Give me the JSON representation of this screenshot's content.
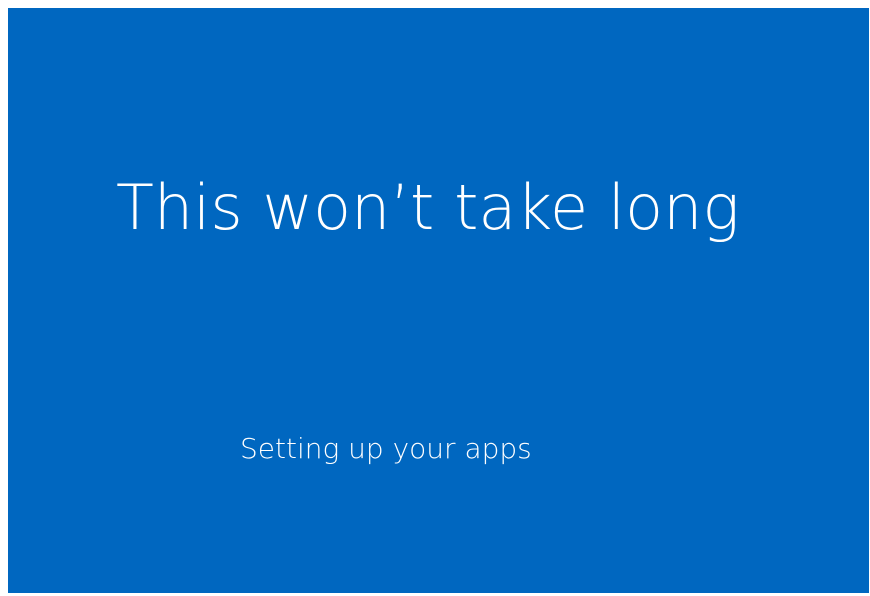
{
  "screen": {
    "background_color": "#0067c0",
    "text_color": "#ffffff",
    "title": "This won’t take long",
    "status": "Setting up your apps"
  }
}
